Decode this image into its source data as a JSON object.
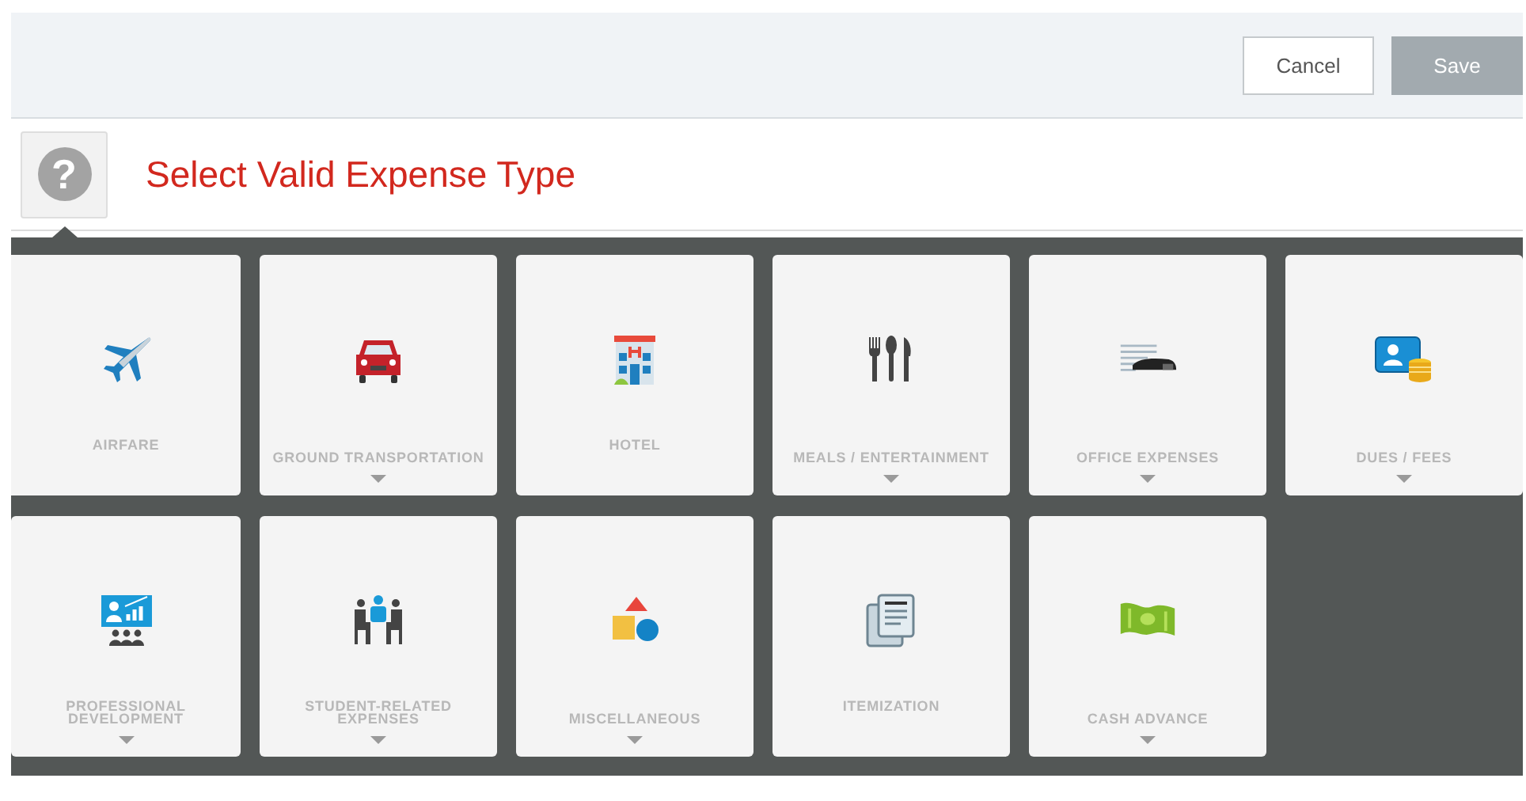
{
  "toolbar": {
    "buttons": [
      {
        "label": "Cancel",
        "disabled": false
      },
      {
        "label": "Save",
        "disabled": true
      }
    ]
  },
  "header": {
    "help_glyph": "?",
    "title": "Select Valid Expense Type"
  },
  "expense_types": [
    {
      "label": "AIRFARE",
      "expandable": false
    },
    {
      "label": "GROUND TRANSPORTATION",
      "expandable": true
    },
    {
      "label": "HOTEL",
      "expandable": false
    },
    {
      "label": "MEALS / ENTERTAINMENT",
      "expandable": true
    },
    {
      "label": "OFFICE EXPENSES",
      "expandable": true
    },
    {
      "label": "DUES / FEES",
      "expandable": true
    },
    {
      "label": "PROFESSIONAL DEVELOPMENT",
      "expandable": true
    },
    {
      "label": "STUDENT-RELATED EXPENSES",
      "expandable": true
    },
    {
      "label": "MISCELLANEOUS",
      "expandable": true
    },
    {
      "label": "ITEMIZATION",
      "expandable": false
    },
    {
      "label": "CASH ADVANCE",
      "expandable": true
    }
  ]
}
